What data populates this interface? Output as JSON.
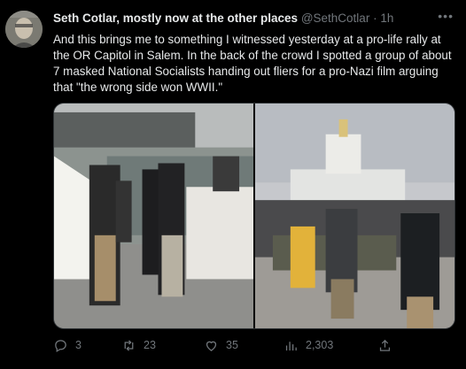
{
  "tweet": {
    "author_name": "Seth Cotlar, mostly now at the other places",
    "author_handle": "@SethCotlar",
    "separator": "·",
    "timestamp": "1h",
    "more_icon": "ellipsis-icon",
    "text": "And this brings me to something I witnessed yesterday at a pro-life rally at the OR Capitol in Salem. In the back of the crowd I spotted a group of about 7 masked National Socialists handing out fliers for a pro-Nazi film arguing that \"the wrong side won WWII.\""
  },
  "actions": {
    "replies": "3",
    "retweets": "23",
    "likes": "35",
    "views": "2,303",
    "icons": [
      "reply-icon",
      "retweet-icon",
      "like-icon",
      "views-icon",
      "share-icon"
    ]
  },
  "colors": {
    "background": "#000000",
    "text": "#e7e9ea",
    "muted": "#71767b",
    "border": "#2f3336"
  }
}
